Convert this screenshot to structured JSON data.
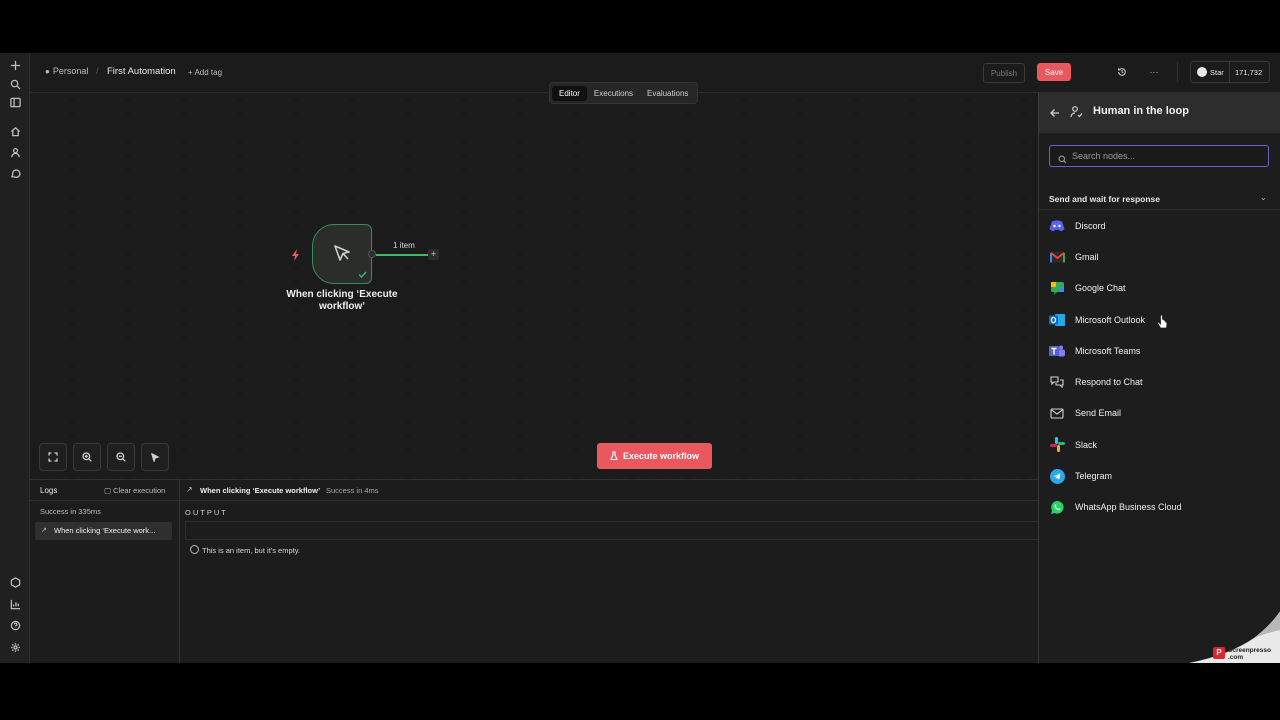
{
  "header": {
    "project": "Personal",
    "workflow_name": "First Automation",
    "add_tag": "+ Add tag",
    "publish_label": "Publish",
    "save_label": "Save",
    "more_label": "···",
    "github_star_label": "Star",
    "github_star_count": "171,732"
  },
  "tabs": [
    {
      "label": "Editor",
      "active": true
    },
    {
      "label": "Executions",
      "active": false
    },
    {
      "label": "Evaluations",
      "active": false
    }
  ],
  "canvas": {
    "trigger_node_title": "When clicking ‘Execute workflow’",
    "connection_label": "1 item",
    "execute_button_label": "Execute workflow"
  },
  "logs": {
    "title": "Logs",
    "clear_label": "Clear execution",
    "summary": "Success in 335ms",
    "entry": "When clicking ‘Execute work...",
    "detail_title": "When clicking ‘Execute workflow’",
    "detail_status": "Success in 4ms",
    "output_label": "OUTPUT",
    "empty_message": "This is an item, but it's empty."
  },
  "panel": {
    "title": "Human in the loop",
    "search_placeholder": "Search nodes...",
    "section_title": "Send and wait for response",
    "nodes": [
      {
        "label": "Discord",
        "icon": "discord-icon",
        "color": "#5865F2"
      },
      {
        "label": "Gmail",
        "icon": "gmail-icon",
        "color": "#EA4335"
      },
      {
        "label": "Google Chat",
        "icon": "google-chat-icon",
        "color": "#34A853"
      },
      {
        "label": "Microsoft Outlook",
        "icon": "outlook-icon",
        "color": "#0F6CBD"
      },
      {
        "label": "Microsoft Teams",
        "icon": "teams-icon",
        "color": "#5B5FC7"
      },
      {
        "label": "Respond to Chat",
        "icon": "chat-bubbles-icon",
        "color": "#d0d0d0"
      },
      {
        "label": "Send Email",
        "icon": "envelope-icon",
        "color": "#d0d0d0"
      },
      {
        "label": "Slack",
        "icon": "slack-icon",
        "color": "#E01E5A"
      },
      {
        "label": "Telegram",
        "icon": "telegram-icon",
        "color": "#29A9EB"
      },
      {
        "label": "WhatsApp Business Cloud",
        "icon": "whatsapp-icon",
        "color": "#25D366"
      }
    ]
  },
  "watermark": "Screenpresso .com",
  "colors": {
    "accent": "#e9585f",
    "success": "#3a8d5a",
    "focus": "#6b63c7"
  }
}
